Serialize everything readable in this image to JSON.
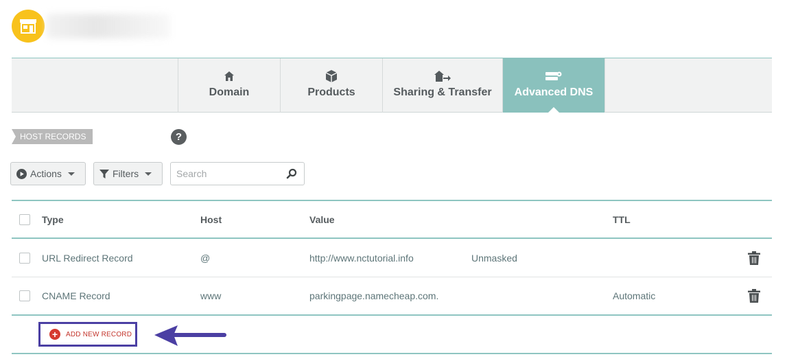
{
  "header": {
    "logo_icon": "storefront-icon",
    "brand_color": "#f8c21c"
  },
  "tabs": [
    {
      "label": "Domain",
      "icon": "house-icon",
      "active": false
    },
    {
      "label": "Products",
      "icon": "box-icon",
      "active": false
    },
    {
      "label": "Sharing & Transfer",
      "icon": "house-arrow-icon",
      "active": false
    },
    {
      "label": "Advanced DNS",
      "icon": "server-gear-icon",
      "active": true
    }
  ],
  "section": {
    "label": "HOST RECORDS",
    "help": "?"
  },
  "toolbar": {
    "actions_label": "Actions",
    "filters_label": "Filters",
    "search_placeholder": "Search"
  },
  "table": {
    "columns": [
      "Type",
      "Host",
      "Value",
      "TTL"
    ],
    "rows": [
      {
        "type": "URL Redirect Record",
        "host": "@",
        "value": "http://www.nctutorial.info",
        "extra": "Unmasked",
        "ttl": ""
      },
      {
        "type": "CNAME Record",
        "host": "www",
        "value": "parkingpage.namecheap.com.",
        "extra": "",
        "ttl": "Automatic"
      }
    ]
  },
  "add_record": {
    "label": "ADD NEW RECORD"
  },
  "colors": {
    "accent_teal": "#8ac1bd",
    "highlight_border": "#4b3fa3",
    "add_red": "#d63a2f"
  }
}
